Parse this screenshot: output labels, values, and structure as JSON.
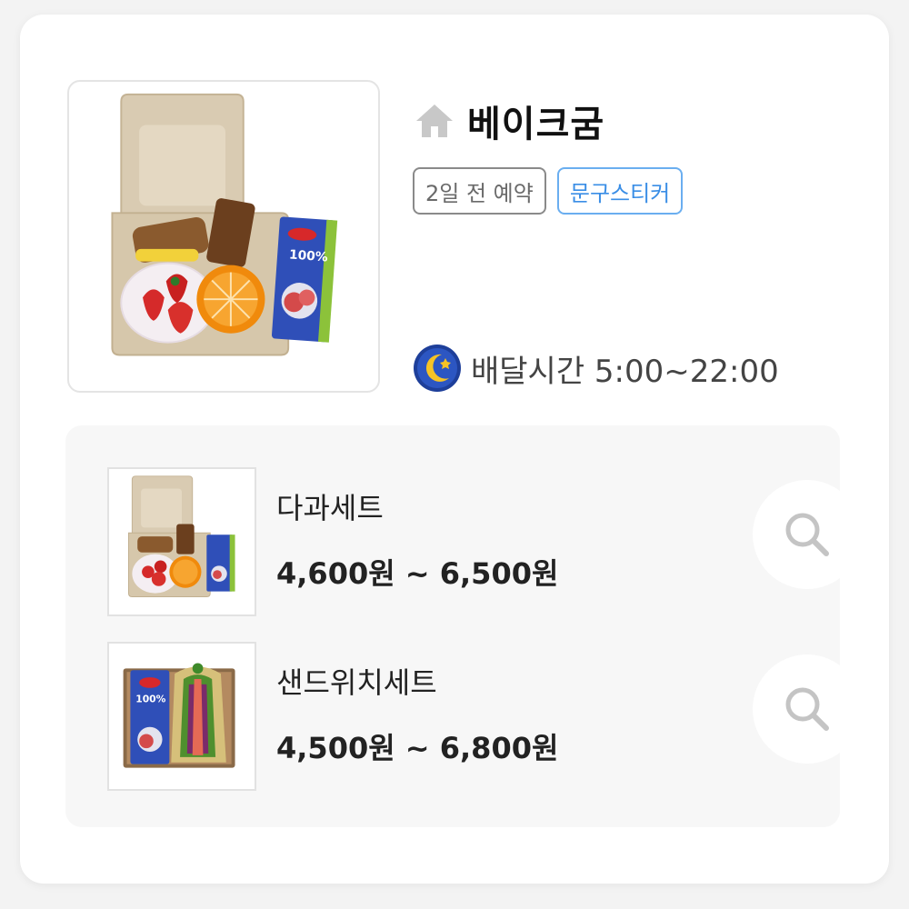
{
  "store": {
    "name": "베이크굼",
    "home_icon": "home-icon",
    "tags": [
      {
        "label": "2일 전 예약",
        "style": "gray",
        "color": "#6a6a6a"
      },
      {
        "label": "문구스티커",
        "style": "blue",
        "color": "#3a8ee6"
      }
    ],
    "delivery": {
      "icon": "moon-icon",
      "text": "배달시간 5:00~22:00"
    }
  },
  "menu": {
    "items": [
      {
        "name": "다과세트",
        "price": "4,600원 ~ 6,500원",
        "action_icon": "search-icon"
      },
      {
        "name": "샌드위치세트",
        "price": "4,500원 ~ 6,800원",
        "action_icon": "search-icon"
      }
    ]
  },
  "colors": {
    "accent_blue": "#3a8ee6",
    "panel_bg": "#f7f7f7",
    "icon_gray": "#c8c8c8"
  }
}
